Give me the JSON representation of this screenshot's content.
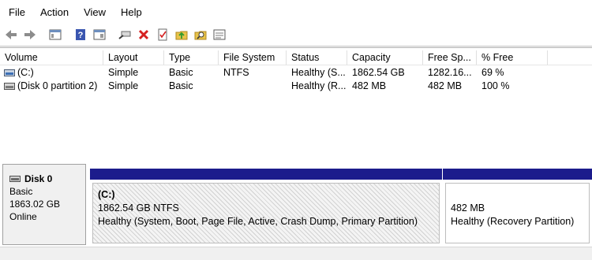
{
  "menu": [
    "File",
    "Action",
    "View",
    "Help"
  ],
  "toolbar": {
    "icons": [
      "back-icon",
      "forward-icon",
      "console-tree-icon",
      "help-icon",
      "properties-view-icon",
      "connect-icon",
      "delete-icon",
      "checklist-icon",
      "folder-up-icon",
      "search-folder-icon",
      "list-icon"
    ],
    "colors": {
      "delete": "#d52020",
      "help": "#3a56b0",
      "folder": "#e8c34a"
    }
  },
  "columns": [
    "Volume",
    "Layout",
    "Type",
    "File System",
    "Status",
    "Capacity",
    "Free Sp...",
    "% Free"
  ],
  "volumes": [
    {
      "volume": "(C:)",
      "layout": "Simple",
      "type": "Basic",
      "fs": "NTFS",
      "status": "Healthy (S...",
      "capacity": "1862.54 GB",
      "free": "1282.16...",
      "pct": "69 %"
    },
    {
      "volume": "(Disk 0 partition 2)",
      "layout": "Simple",
      "type": "Basic",
      "fs": "",
      "status": "Healthy (R...",
      "capacity": "482 MB",
      "free": "482 MB",
      "pct": "100 %"
    }
  ],
  "disk": {
    "name": "Disk 0",
    "type": "Basic",
    "size": "1863.02 GB",
    "state": "Online",
    "bar_color": "#1c1c8c"
  },
  "partitions": [
    {
      "title": "(C:)",
      "size": "1862.54 GB NTFS",
      "status": "Healthy (System, Boot, Page File, Active, Crash Dump, Primary Partition)"
    },
    {
      "title": "",
      "size": "482 MB",
      "status": "Healthy (Recovery Partition)"
    }
  ]
}
